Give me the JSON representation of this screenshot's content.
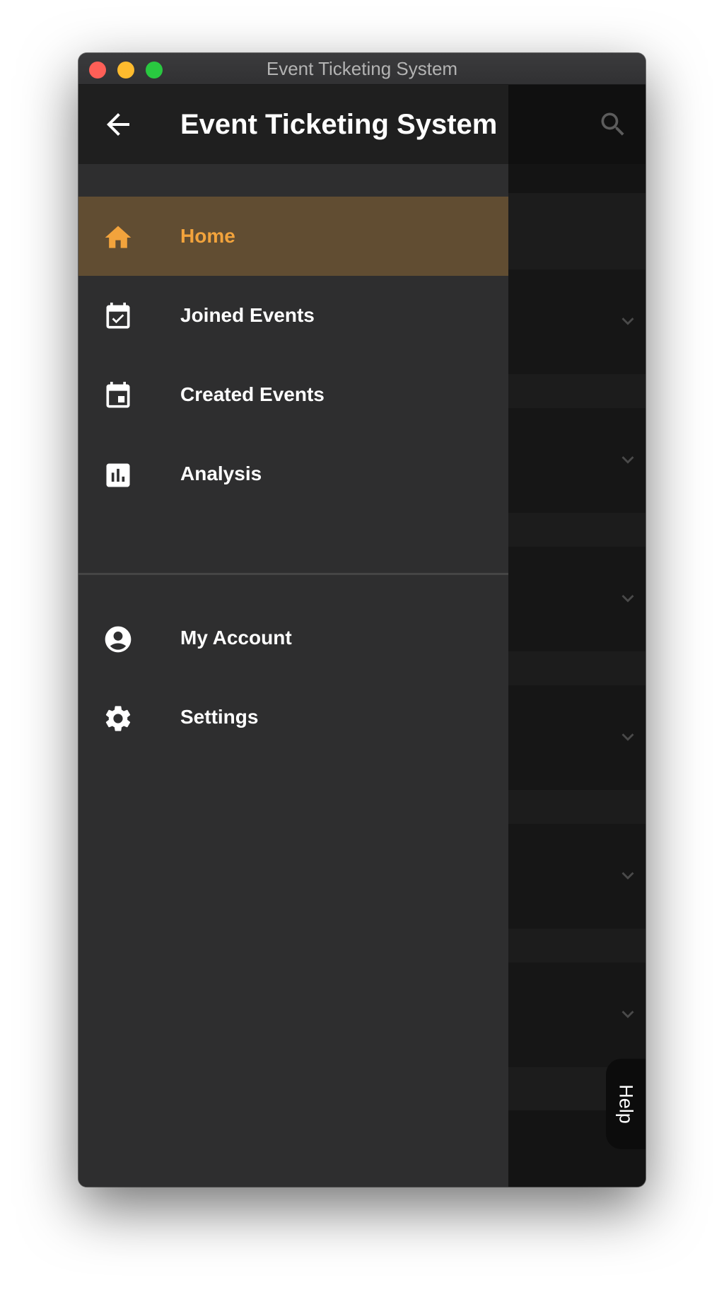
{
  "window": {
    "title": "Event Ticketing System"
  },
  "drawer": {
    "title": "Event Ticketing System",
    "items": [
      {
        "label": "Home",
        "icon": "home-icon",
        "active": true
      },
      {
        "label": "Joined Events",
        "icon": "event-available-icon"
      },
      {
        "label": "Created Events",
        "icon": "event-icon"
      },
      {
        "label": "Analysis",
        "icon": "bar-chart-icon"
      }
    ],
    "secondary_items": [
      {
        "label": "My Account",
        "icon": "account-circle-icon"
      },
      {
        "label": "Settings",
        "icon": "gear-icon"
      }
    ]
  },
  "help": {
    "label": "Help"
  },
  "colors": {
    "accent": "#f2a33c",
    "active_bg": "#614d32",
    "drawer_bg": "#2e2e2f",
    "header_bg": "#1f1f1f"
  }
}
